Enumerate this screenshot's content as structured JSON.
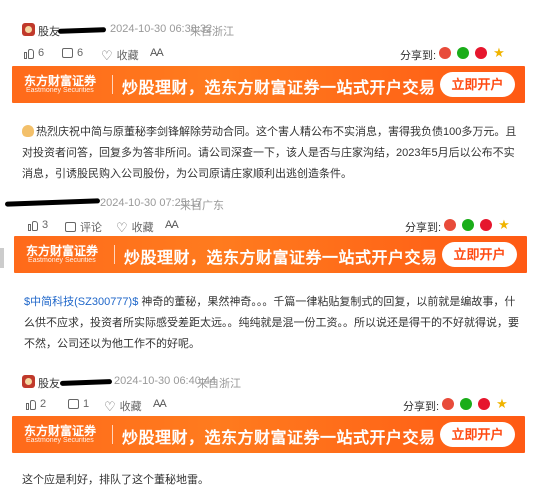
{
  "posts": [
    {
      "user": "股友",
      "time": "2024-10-30 06:38:32",
      "location": "来自浙江",
      "likes": "6",
      "comments": "6",
      "favorite_label": "收藏",
      "font_label": "AA",
      "share_label": "分享到:",
      "content_prefix": "",
      "content": "热烈庆祝中简与原董秘李剑锋解除劳动合同。这个害人精公布不实消息，害得我负债100多万元。且对投资者问答，回复多为答非所问。请公司深查一下，该人是否与庄家沟结，2023年5月后以公布不实消息，引诱股民购入公司股份，为公司原请庄家顺利出逃创造条件。"
    },
    {
      "user": "",
      "time": "2024-10-30 07:25:17",
      "location": "来自广东",
      "likes": "3",
      "comments": "评论",
      "favorite_label": "收藏",
      "font_label": "AA",
      "share_label": "分享到:",
      "content_prefix": "$中简科技(SZ300777)$",
      "content": " 神奇的董秘，果然神奇。。。千篇一律粘贴复制式的回复，以前就是编故事，什么供不应求，投资者所实际感受差距太远。。纯纯就是混一份工资。。所以说还是得干的不好就得说，要不然，公司还以为他工作不的好呢。"
    },
    {
      "user": "股友",
      "time": "2024-10-30 06:40:44",
      "location": "来自浙江",
      "likes": "2",
      "comments": "1",
      "favorite_label": "收藏",
      "font_label": "AA",
      "share_label": "分享到:",
      "content_prefix": "",
      "content": "这个应是利好，排队了这个董秘地雷。"
    }
  ],
  "banner": {
    "logo_cn": "东方财富证券",
    "logo_en": "Eastmoney Securities",
    "slogan": "炒股理财，选东方财富证券一站式开户交易",
    "button": "立即开户"
  },
  "icons": [
    "avatar",
    "like-icon",
    "comment-icon",
    "heart-icon",
    "font-size-icon",
    "weibo-icon",
    "wechat-icon",
    "share-circle-icon",
    "star-icon",
    "peace-sign-icon"
  ],
  "colors": {
    "banner_orange": "#ff6a1a",
    "link_blue": "#1e66c9",
    "star_yellow": "#f0b400"
  }
}
